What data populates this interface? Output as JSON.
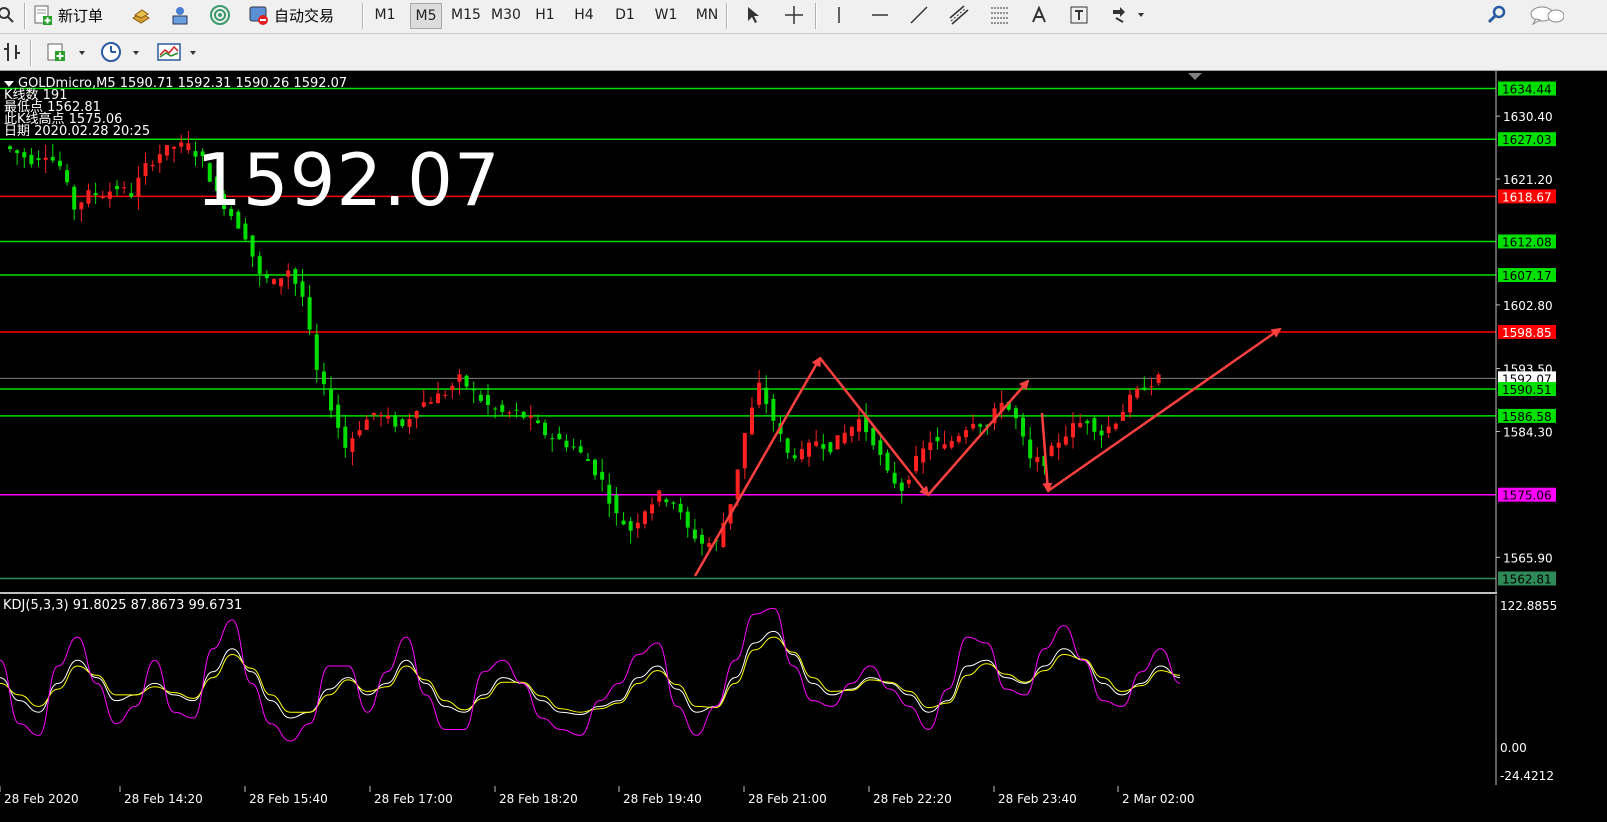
{
  "toolbar1": {
    "new_order_label": "新订单",
    "autotrade_label": "自动交易",
    "timeframes": [
      "M1",
      "M5",
      "M15",
      "M30",
      "H1",
      "H4",
      "D1",
      "W1",
      "MN"
    ],
    "icons": [
      "new-order-icon",
      "gold-icon",
      "market-watch-icon",
      "signal-icon",
      "autotrade-icon",
      "cursor-icon",
      "crosshair-icon",
      "vertical-line-icon",
      "horizontal-line-icon",
      "trendline-icon",
      "equidistant-channel-icon",
      "fibonacci-icon",
      "text-icon",
      "text-label-icon",
      "arrow-tools-icon",
      "search-icon",
      "chat-icon"
    ]
  },
  "toolbar2": {
    "icons": [
      "periodicity-icon",
      "indicators-icon",
      "clock-icon",
      "templates-icon"
    ]
  },
  "chart": {
    "symbol_line": "GOLDmicro,M5  1590.71 1592.31 1590.26 1592.07",
    "info_lines": [
      "K线数  191",
      "最低点 1562.81",
      "此K线高点 1575.06",
      "日期 2020.02.28 20:25"
    ],
    "big_price": "1592.07",
    "price_axis_ticks": [
      "1630.40",
      "1621.20",
      "1602.80",
      "1593.50",
      "1584.30",
      "1565.90"
    ],
    "levels": [
      {
        "price": "1634.44",
        "color": "#00e000"
      },
      {
        "price": "1627.03",
        "color": "#00e000"
      },
      {
        "price": "1618.67",
        "color": "#ff0000"
      },
      {
        "price": "1612.08",
        "color": "#00e000"
      },
      {
        "price": "1607.17",
        "color": "#00e000"
      },
      {
        "price": "1598.85",
        "color": "#ff0000"
      },
      {
        "price": "1592.07",
        "color": "#ffffff"
      },
      {
        "price": "1590.51",
        "color": "#00e000"
      },
      {
        "price": "1586.58",
        "color": "#00e000"
      },
      {
        "price": "1575.06",
        "color": "#ff00ff"
      },
      {
        "price": "1562.81",
        "color": "#2e8b57"
      }
    ],
    "time_labels": [
      "28 Feb 2020",
      "28 Feb 14:20",
      "28 Feb 15:40",
      "28 Feb 17:00",
      "28 Feb 18:20",
      "28 Feb 19:40",
      "28 Feb 21:00",
      "28 Feb 22:20",
      "28 Feb 23:40",
      "2 Mar 02:00"
    ],
    "bull_color": "#ff2020",
    "bear_color": "#00e000",
    "arrow_color": "#ff4040"
  },
  "kdj": {
    "label": "KDJ(5,3,3) 91.8025 87.8673 99.6731",
    "axis_ticks": [
      "122.8855",
      "0.00",
      "-24.4212"
    ],
    "k_color": "#ffffff",
    "d_color": "#ffff00",
    "j_color": "#ff00ff"
  },
  "chart_data": {
    "type": "candlestick",
    "title": "GOLDmicro,M5  1590.71 1592.31 1590.26 1592.07",
    "ylim": [
      1560,
      1637
    ],
    "x_ticks": [
      "28 Feb 2020",
      "28 Feb 14:20",
      "28 Feb 15:40",
      "28 Feb 17:00",
      "28 Feb 18:20",
      "28 Feb 19:40",
      "28 Feb 21:00",
      "28 Feb 22:20",
      "28 Feb 23:40",
      "2 Mar 02:00"
    ],
    "close_path": [
      1626,
      1625,
      1624,
      1625,
      1623,
      1617,
      1619,
      1619,
      1620,
      1619,
      1623,
      1625,
      1626,
      1626,
      1624,
      1619,
      1616,
      1613,
      1607,
      1606,
      1608,
      1604,
      1593,
      1588,
      1582,
      1585,
      1587,
      1586,
      1585,
      1588,
      1589,
      1590,
      1592,
      1590,
      1588,
      1587,
      1587,
      1586,
      1584,
      1583,
      1582,
      1580,
      1577,
      1572,
      1570,
      1573,
      1575,
      1574,
      1570,
      1568,
      1568,
      1574,
      1584,
      1591,
      1586,
      1581,
      1581,
      1583,
      1582,
      1584,
      1586,
      1583,
      1578,
      1576,
      1580,
      1583,
      1582,
      1584,
      1586,
      1585,
      1589,
      1586,
      1580,
      1580,
      1583,
      1585,
      1586,
      1584,
      1586,
      1589,
      1591,
      1592
    ],
    "horizontal_levels": [
      1634.44,
      1627.03,
      1618.67,
      1612.08,
      1607.17,
      1598.85,
      1592.07,
      1590.51,
      1586.58,
      1575.06,
      1562.81
    ],
    "kdj_series": [
      {
        "name": "K",
        "values": [
          60,
          40,
          30,
          55,
          75,
          60,
          40,
          45,
          55,
          45,
          40,
          65,
          85,
          65,
          40,
          25,
          30,
          50,
          60,
          45,
          55,
          75,
          55,
          35,
          30,
          45,
          60,
          55,
          40,
          30,
          28,
          35,
          40,
          60,
          70,
          50,
          30,
          35,
          60,
          90,
          100,
          80,
          55,
          45,
          50,
          60,
          55,
          45,
          30,
          40,
          70,
          75,
          60,
          55,
          70,
          85,
          75,
          55,
          45,
          55,
          70,
          60
        ]
      },
      {
        "name": "D",
        "values": [
          55,
          45,
          35,
          50,
          70,
          62,
          45,
          45,
          52,
          47,
          42,
          60,
          80,
          68,
          45,
          30,
          30,
          45,
          58,
          48,
          52,
          70,
          58,
          40,
          32,
          42,
          56,
          56,
          44,
          33,
          30,
          33,
          38,
          55,
          66,
          54,
          35,
          34,
          55,
          84,
          95,
          82,
          60,
          48,
          49,
          58,
          56,
          48,
          34,
          38,
          62,
          72,
          63,
          56,
          66,
          80,
          76,
          60,
          48,
          53,
          66,
          62
        ]
      },
      {
        "name": "J",
        "values": [
          75,
          20,
          10,
          70,
          95,
          55,
          20,
          35,
          75,
          30,
          25,
          85,
          110,
          55,
          20,
          5,
          20,
          70,
          70,
          30,
          65,
          95,
          45,
          15,
          15,
          65,
          75,
          55,
          25,
          15,
          10,
          40,
          55,
          80,
          90,
          35,
          10,
          35,
          75,
          115,
          120,
          70,
          40,
          35,
          55,
          70,
          50,
          35,
          15,
          50,
          95,
          90,
          50,
          45,
          85,
          105,
          75,
          40,
          35,
          65,
          85,
          55
        ]
      }
    ],
    "kdj_ylim": [
      -24.4212,
      122.8855
    ],
    "legend": "top-left"
  }
}
